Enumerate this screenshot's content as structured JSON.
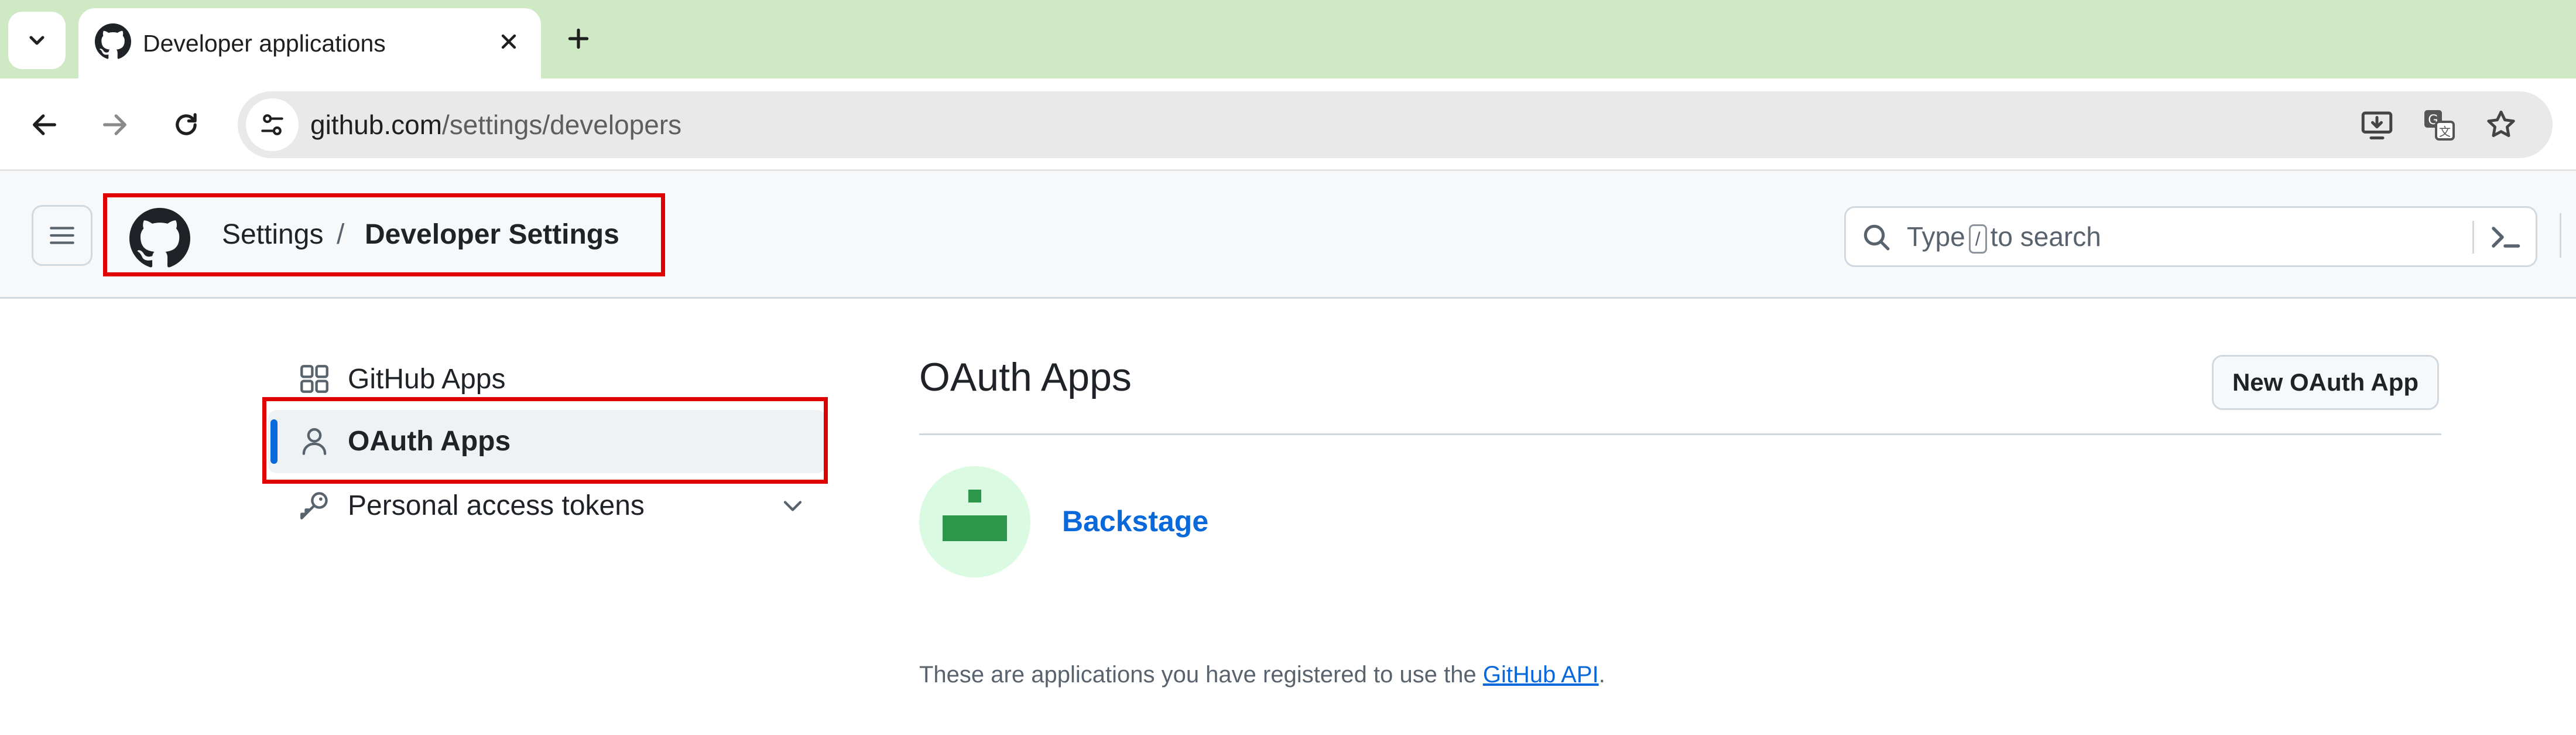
{
  "browser": {
    "tab": {
      "title": "Developer applications"
    },
    "address_bar": {
      "host": "github.com",
      "path": "/settings/developers"
    }
  },
  "header": {
    "breadcrumb": {
      "settings": "Settings",
      "separator": "/",
      "current": "Developer Settings"
    },
    "search": {
      "before_key": "Type",
      "key": "/",
      "after_key": "to search"
    }
  },
  "sidebar": {
    "items": [
      {
        "label": "GitHub Apps",
        "icon": "apps-grid-icon"
      },
      {
        "label": "OAuth Apps",
        "icon": "person-icon",
        "active": true
      },
      {
        "label": "Personal access tokens",
        "icon": "key-icon",
        "expandable": true
      }
    ]
  },
  "main": {
    "title": "OAuth Apps",
    "new_button": "New OAuth App",
    "apps": [
      {
        "name": "Backstage"
      }
    ],
    "footnote": {
      "text": "These are applications you have registered to use the",
      "link": "GitHub API",
      "end": "."
    }
  },
  "colors": {
    "tabstrip": "#cfe9c5",
    "link": "#0969da",
    "highlight": "#e00000",
    "avatar_bg": "#dafbe1",
    "avatar_fg": "#2c974b"
  }
}
